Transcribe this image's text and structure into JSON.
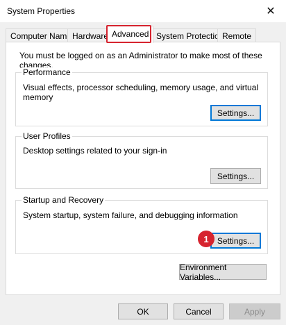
{
  "window": {
    "title": "System Properties",
    "close_glyph": "✕"
  },
  "tabs": [
    {
      "label": "Computer Name"
    },
    {
      "label": "Hardware"
    },
    {
      "label": "Advanced"
    },
    {
      "label": "System Protection"
    },
    {
      "label": "Remote"
    }
  ],
  "active_tab": "Advanced",
  "admin_note": "You must be logged on as an Administrator to make most of these changes.",
  "performance": {
    "title": "Performance",
    "description": "Visual effects, processor scheduling, memory usage, and virtual memory",
    "button_label": "Settings..."
  },
  "user_profiles": {
    "title": "User Profiles",
    "description": "Desktop settings related to your sign-in",
    "button_label": "Settings..."
  },
  "startup_recovery": {
    "title": "Startup and Recovery",
    "description": "System startup, system failure, and debugging information",
    "button_label": "Settings...",
    "step_badge": "1"
  },
  "env_vars_button": "Environment Variables...",
  "footer": {
    "ok": "OK",
    "cancel": "Cancel",
    "apply": "Apply"
  },
  "colors": {
    "highlight": "#d6242f",
    "focus": "#0078d7"
  }
}
